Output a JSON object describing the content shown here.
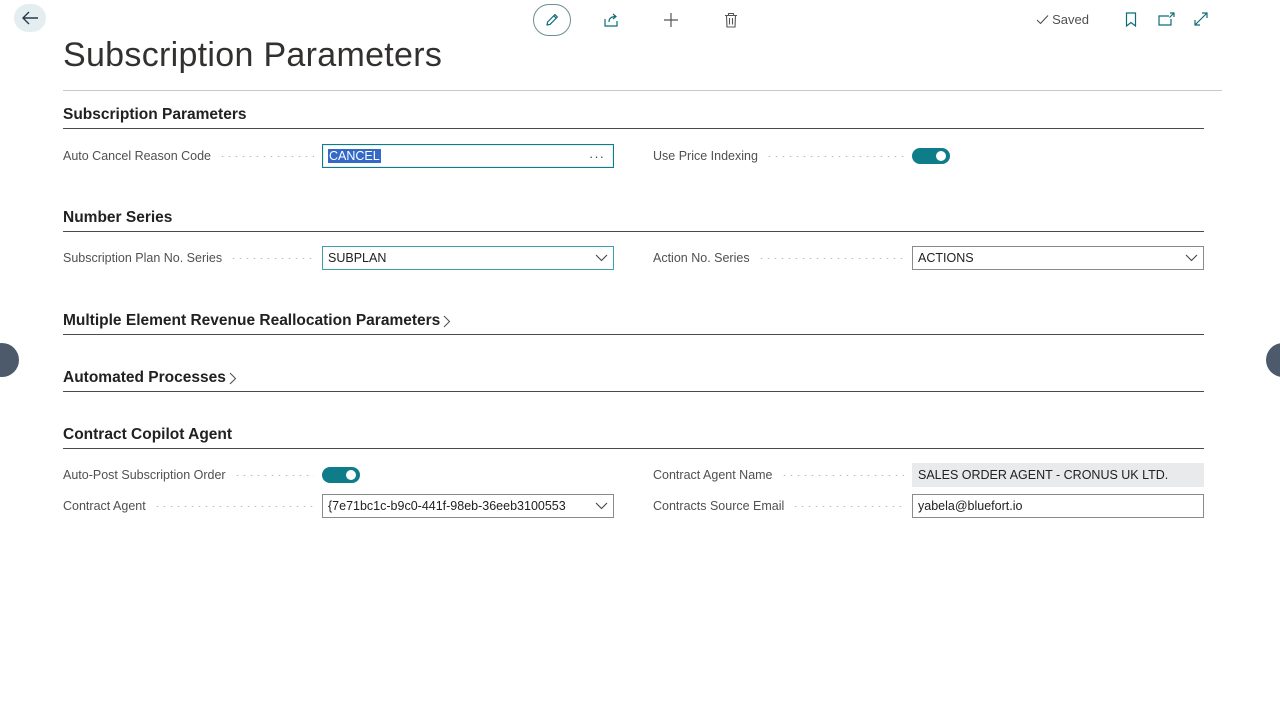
{
  "toolbar": {
    "saved_label": "Saved"
  },
  "page": {
    "title": "Subscription Parameters"
  },
  "sections": {
    "subscription_parameters": {
      "title": "Subscription Parameters",
      "auto_cancel_reason_code": {
        "label": "Auto Cancel Reason Code",
        "value": "CANCEL"
      },
      "use_price_indexing": {
        "label": "Use Price Indexing",
        "value": true
      }
    },
    "number_series": {
      "title": "Number Series",
      "subscription_plan_no_series": {
        "label": "Subscription Plan No. Series",
        "value": "SUBPLAN"
      },
      "action_no_series": {
        "label": "Action No. Series",
        "value": "ACTIONS"
      }
    },
    "merr_parameters": {
      "title": "Multiple Element Revenue Reallocation Parameters"
    },
    "automated_processes": {
      "title": "Automated Processes"
    },
    "contract_copilot_agent": {
      "title": "Contract Copilot Agent",
      "auto_post_subscription_order": {
        "label": "Auto-Post Subscription Order",
        "value": true
      },
      "contract_agent": {
        "label": "Contract Agent",
        "value": "{7e71bc1c-b9c0-441f-98eb-36eeb3100553"
      },
      "contract_agent_name": {
        "label": "Contract Agent Name",
        "value": "SALES ORDER AGENT - CRONUS UK LTD."
      },
      "contracts_source_email": {
        "label": "Contracts Source Email",
        "value": "yabela@bluefort.io"
      }
    }
  },
  "colors": {
    "accent": "#0f7c8a",
    "selection": "#3469c8",
    "readonly_bg": "#e9eaeb",
    "side_nav": "#4d5a6b"
  },
  "icons": [
    "back-arrow-icon",
    "edit-pencil-icon",
    "share-icon",
    "plus-icon",
    "delete-icon",
    "check-icon",
    "bookmark-icon",
    "open-new-window-icon",
    "expand-icon",
    "chevron-right-icon",
    "chevron-down-icon",
    "ellipsis-icon"
  ]
}
